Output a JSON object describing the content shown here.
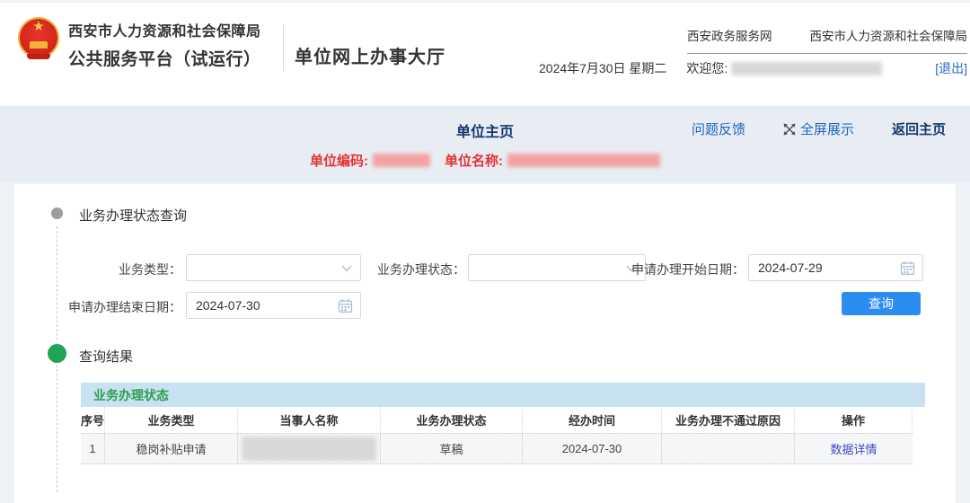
{
  "colors": {
    "accent_blue": "#2d8cf0",
    "navy": "#16386e",
    "link_blue": "#2065c0",
    "alert_red": "#e63232",
    "table_title_green": "#2f9e50",
    "table_title_bg": "#c9e2f1",
    "banner_bg": "#e8edf4"
  },
  "header": {
    "org_line1": "西安市人力资源和社会保障局",
    "org_line2": "公共服务平台（试运行）",
    "portal_title": "单位网上办事大厅",
    "top_links": [
      "西安政务服务网",
      "西安市人力资源和社会保障局"
    ],
    "date_text": "2024年7月30日  星期二",
    "welcome_label": "欢迎您:",
    "logout_label": "[退出]"
  },
  "banner": {
    "page_title": "单位主页",
    "feedback": "问题反馈",
    "fullscreen": "全屏展示",
    "home": "返回主页",
    "unit_code_label": "单位编码:",
    "unit_name_label": "单位名称:"
  },
  "query": {
    "title": "业务办理状态查询",
    "business_type_label": "业务类型：",
    "status_label": "业务办理状态：",
    "start_date_label": "申请办理开始日期：",
    "start_date_value": "2024-07-29",
    "end_date_label": "申请办理结束日期：",
    "end_date_value": "2024-07-30",
    "search_button": "查询"
  },
  "results": {
    "title": "查询结果",
    "table_title": "业务办理状态",
    "columns": [
      "序号",
      "业务类型",
      "当事人名称",
      "业务办理状态",
      "经办时间",
      "业务办理不通过原因",
      "操作"
    ],
    "rows": [
      {
        "index": "1",
        "business_type": "稳岗补贴申请",
        "status": "草稿",
        "time": "2024-07-30",
        "fail_reason": "",
        "action": "数据详情"
      }
    ]
  }
}
